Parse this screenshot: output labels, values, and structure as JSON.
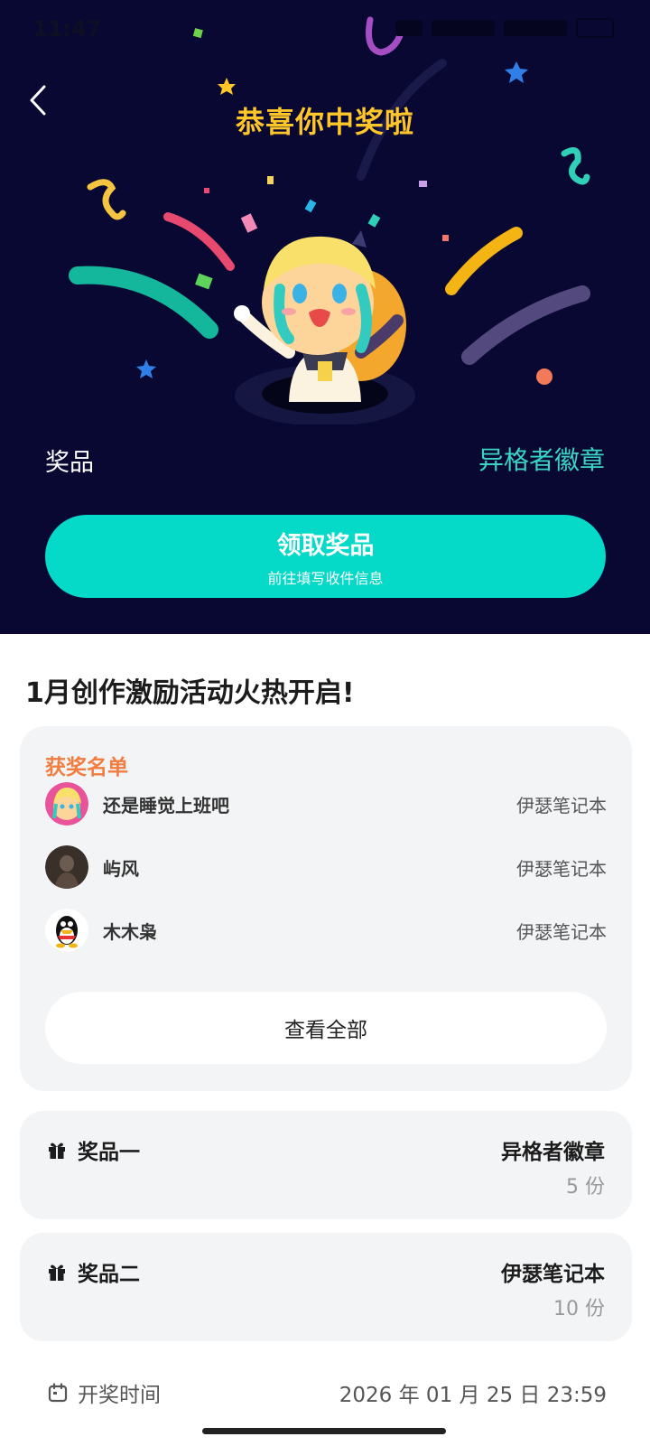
{
  "status_bar": {
    "time": "11:47"
  },
  "hero": {
    "title": "恭喜你中奖啦",
    "prize_label": "奖品",
    "prize_value": "异格者徽章",
    "claim_button": {
      "label": "领取奖品",
      "sublabel": "前往填写收件信息"
    }
  },
  "event": {
    "title": "1月创作激励活动火热开启!"
  },
  "winners": {
    "title": "获奖名单",
    "list": [
      {
        "name": "还是睡觉上班吧",
        "prize": "伊瑟笔记本"
      },
      {
        "name": "屿风",
        "prize": "伊瑟笔记本"
      },
      {
        "name": "木木枭",
        "prize": "伊瑟笔记本"
      }
    ],
    "view_all_label": "查看全部"
  },
  "prizes": [
    {
      "label": "奖品一",
      "name": "异格者徽章",
      "count": "5 份"
    },
    {
      "label": "奖品二",
      "name": "伊瑟笔记本",
      "count": "10 份"
    }
  ],
  "draw": {
    "label": "开奖时间",
    "time": "2026 年 01 月 25 日 23:59"
  },
  "colors": {
    "hero_bg": "#080833",
    "title_yellow": "#ffc629",
    "accent_teal": "#05d9c8",
    "winners_orange": "#f17d40"
  }
}
